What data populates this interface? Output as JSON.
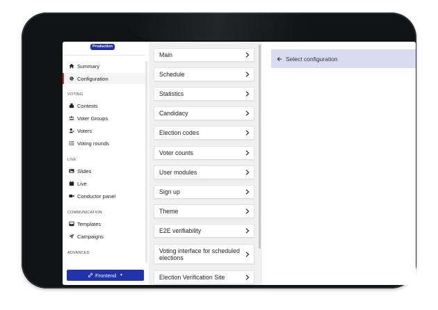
{
  "environment_badge": "Production",
  "sidebar": {
    "top_items": [
      {
        "label": "Summary",
        "icon": "home-icon"
      },
      {
        "label": "Configuration",
        "icon": "gear-icon",
        "active": true
      }
    ],
    "sections": [
      {
        "title": "VOTING",
        "items": [
          {
            "label": "Contests",
            "icon": "ballot-box-icon"
          },
          {
            "label": "Voter Groups",
            "icon": "users-icon"
          },
          {
            "label": "Voters",
            "icon": "user-check-icon"
          },
          {
            "label": "Voting rounds",
            "icon": "list-icon"
          }
        ]
      },
      {
        "title": "LIVE",
        "items": [
          {
            "label": "Slides",
            "icon": "image-icon"
          },
          {
            "label": "Live",
            "icon": "calendar-icon"
          },
          {
            "label": "Conductor panel",
            "icon": "video-icon"
          }
        ]
      },
      {
        "title": "COMMUNICATION",
        "items": [
          {
            "label": "Templates",
            "icon": "inbox-icon"
          },
          {
            "label": "Campaigns",
            "icon": "paper-plane-icon"
          }
        ]
      },
      {
        "title": "ADVANCED",
        "items": []
      }
    ],
    "frontend_button": "Frontend"
  },
  "config_menu": [
    "Main",
    "Schedule",
    "Statistics",
    "Candidacy",
    "Election codes",
    "Voter counts",
    "User modules",
    "Sign up",
    "Theme",
    "E2E verifiability",
    "Voting interface for scheduled elections",
    "Election Verification Site"
  ],
  "right_panel": {
    "select_label": "Select configuration"
  },
  "colors": {
    "primary": "#2233aa",
    "active_indicator": "#d0312d",
    "select_bg": "#d8dcf1",
    "middle_bg": "#f0f0f0"
  }
}
